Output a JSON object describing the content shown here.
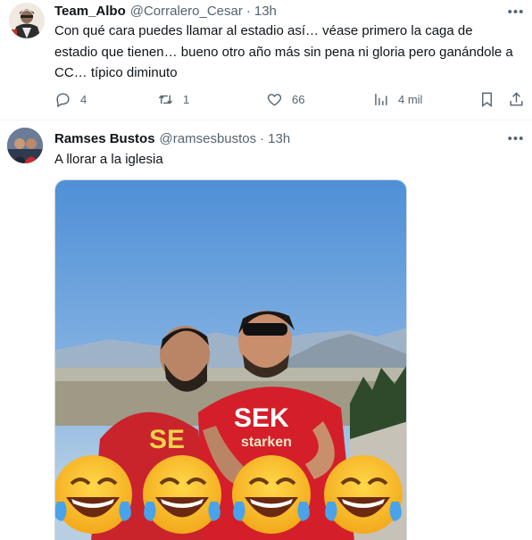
{
  "tweets": [
    {
      "display_name": "Team_Albo",
      "handle": "@Corralero_Cesar",
      "separator": "·",
      "time": "13h",
      "text": "Con qué cara puedes llamar al estadio así… véase primero la caga de estadio que tienen… bueno otro año más sin pena ni gloria pero ganándole a CC… típico diminuto",
      "replies": "4",
      "retweets": "1",
      "likes": "66",
      "views": "4 mil",
      "icons": [
        "reply-icon",
        "retweet-icon",
        "like-icon",
        "views-icon",
        "bookmark-icon",
        "share-icon",
        "more-icon"
      ]
    },
    {
      "display_name": "Ramses Bustos",
      "handle": "@ramsesbustos",
      "separator": "·",
      "time": "13h",
      "text": "A llorar a la iglesia",
      "media": {
        "shirt_text_1": "SEK",
        "shirt_text_2": "starken",
        "shirt_text_left": "SE",
        "emoji": "😂"
      }
    }
  ],
  "colors": {
    "text": "#0f1419",
    "secondary": "#536471",
    "border": "#eff3f4",
    "sky": "#6fa0d6",
    "shirt_red": "#d41f2a"
  }
}
